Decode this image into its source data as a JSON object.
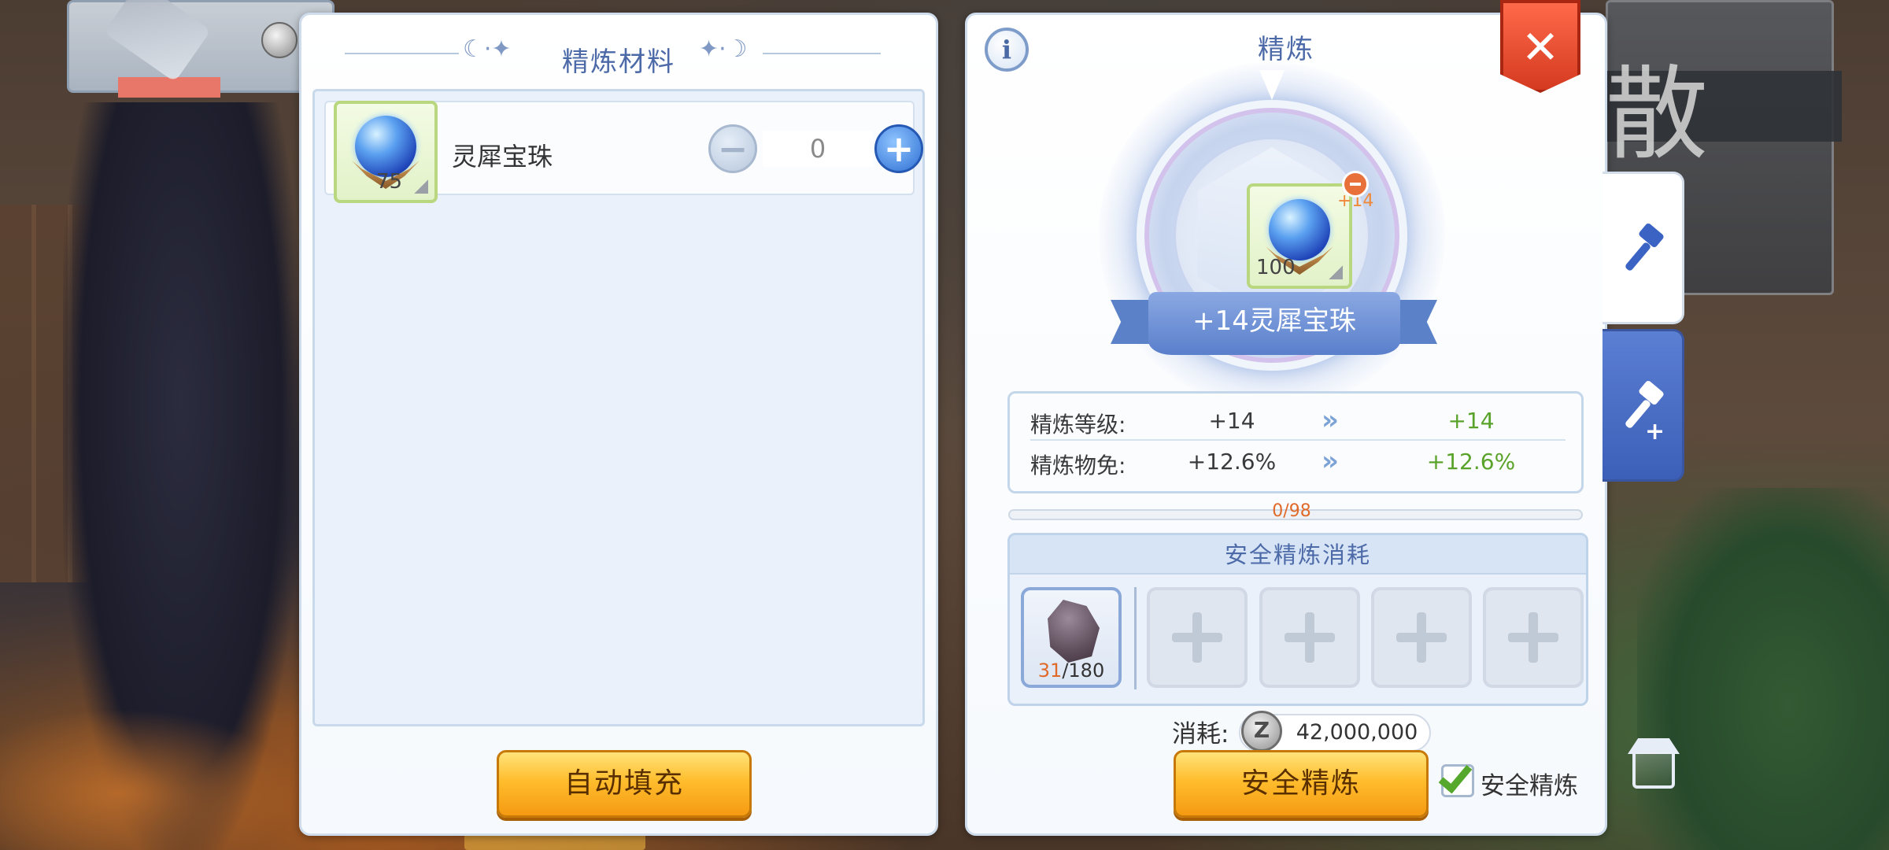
{
  "left_panel": {
    "title": "精炼材料",
    "materials": [
      {
        "name": "灵犀宝珠",
        "owned": "75",
        "quantity": "0",
        "icon": "blue-orb-icon"
      }
    ],
    "auto_fill_label": "自动填充"
  },
  "right_panel": {
    "info_label": "i",
    "title": "精炼",
    "target_item": {
      "name": "+14灵犀宝珠",
      "count": "100",
      "refine_badge": "+14",
      "icon": "blue-orb-icon"
    },
    "stats": [
      {
        "label": "精炼等级:",
        "current": "+14",
        "next": "+14"
      },
      {
        "label": "精炼物免:",
        "current": "+12.6%",
        "next": "+12.6%"
      }
    ],
    "progress": {
      "text": "0/98",
      "value": 0,
      "max": 98
    },
    "safe_cost": {
      "title": "安全精炼消耗",
      "slots": [
        {
          "have": "31",
          "sep": "/",
          "need": "180",
          "icon": "ore-icon"
        },
        {
          "empty": true
        },
        {
          "empty": true
        },
        {
          "empty": true
        },
        {
          "empty": true
        }
      ]
    },
    "zeny": {
      "label": "消耗:",
      "coin": "Z",
      "amount": "42,000,000"
    },
    "safe_refine_label": "安全精炼",
    "checkbox": {
      "label": "安全精炼",
      "checked": true
    }
  },
  "close_label": "✕",
  "side_tabs": [
    {
      "name": "refine",
      "icon": "hammer-icon",
      "active": true
    },
    {
      "name": "refine-plus",
      "icon": "hammer-plus-icon",
      "active": false,
      "plus": "+"
    }
  ],
  "background": {
    "big_char": "散"
  },
  "colors": {
    "panel_title": "#4d6aa8",
    "accent_orange": "#e06a2a",
    "stat_green": "#5aa32a",
    "button_yellow": "#ffbd2d",
    "close_red": "#d43a20",
    "tab_blue": "#3c5fb8"
  }
}
